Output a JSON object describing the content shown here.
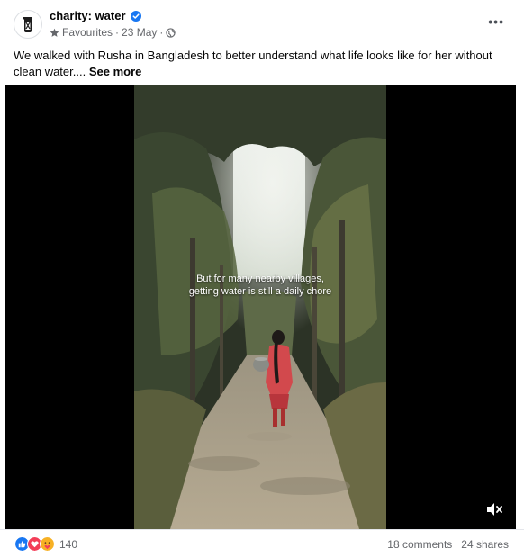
{
  "post": {
    "page_name": "charity: water",
    "meta": {
      "audience": "Favourites",
      "separator": "·",
      "date": "23 May",
      "separator2": "·"
    },
    "caption": "We walked with Rusha in Bangladesh to better understand what life looks like for her without clean water....",
    "see_more": "See more",
    "more_label": "•••"
  },
  "video": {
    "subtitle_line1": "But for many nearby villages,",
    "subtitle_line2": "getting water is still a daily chore"
  },
  "footer": {
    "reaction_count": "140",
    "comments": "18 comments",
    "shares": "24 shares"
  },
  "colors": {
    "verified": "#1877f2",
    "like": "#1877f2",
    "love": "#f33e58",
    "care": "#f7b125",
    "meta_text": "#65676b"
  },
  "icons": [
    "charity-water-logo-icon",
    "verified-badge-icon",
    "star-icon",
    "globe-icon",
    "mute-icon",
    "like-reaction-icon",
    "love-reaction-icon",
    "care-reaction-icon"
  ]
}
